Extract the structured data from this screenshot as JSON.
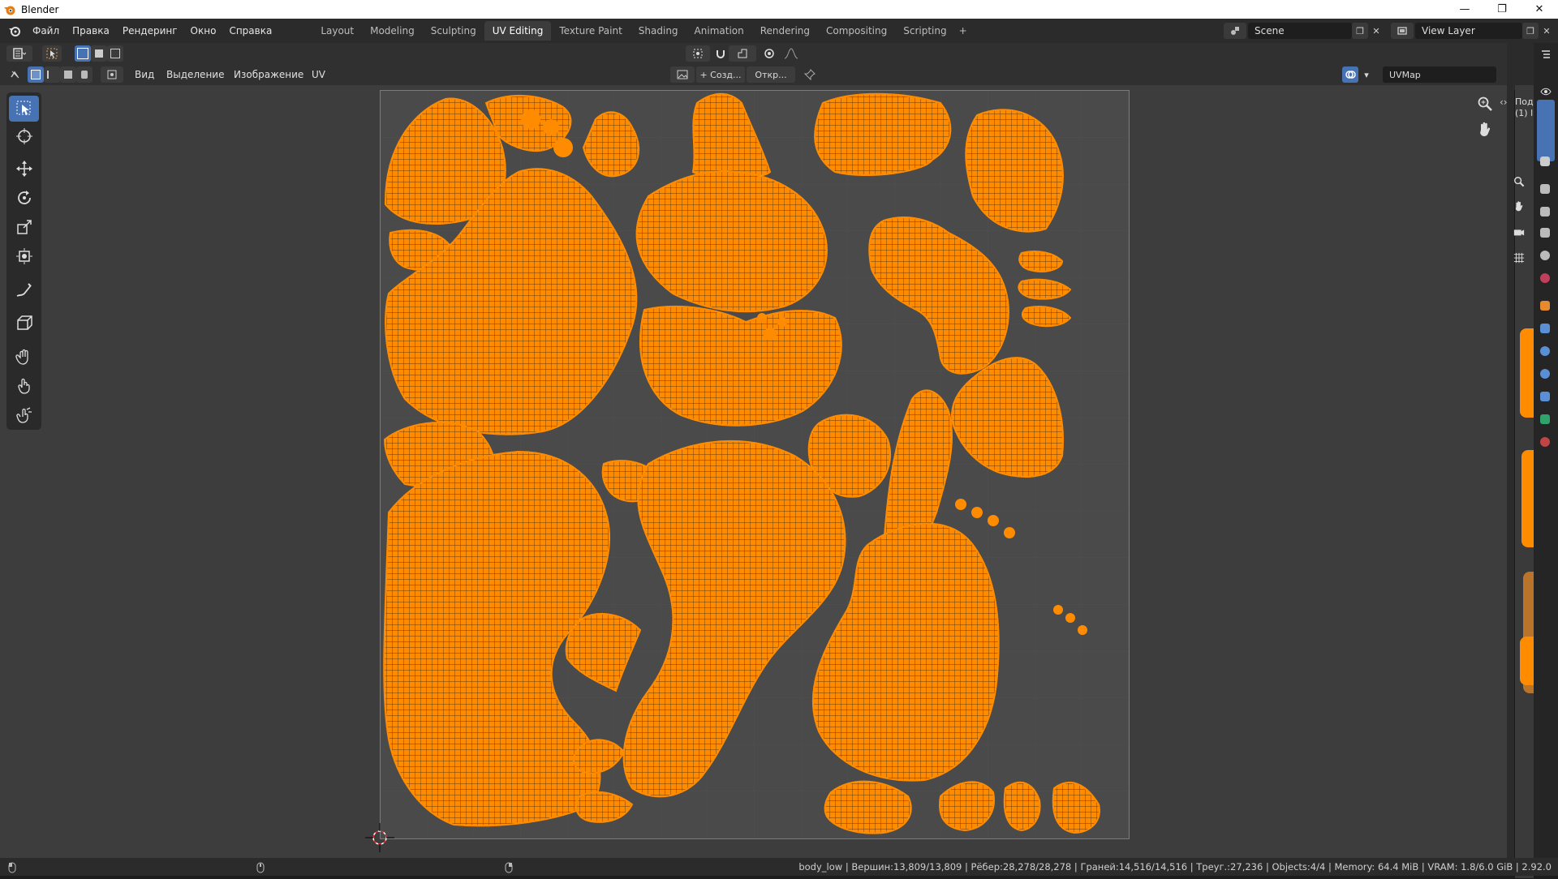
{
  "window": {
    "title": "Blender",
    "controls": {
      "minimize": "—",
      "maximize": "❐",
      "close": "✕"
    }
  },
  "menu": [
    "Файл",
    "Правка",
    "Рендеринг",
    "Окно",
    "Справка"
  ],
  "workspaces": {
    "tabs": [
      "Layout",
      "Modeling",
      "Sculpting",
      "UV Editing",
      "Texture Paint",
      "Shading",
      "Animation",
      "Rendering",
      "Compositing",
      "Scripting"
    ],
    "active": "UV Editing",
    "add": "+"
  },
  "scene": {
    "name": "Scene",
    "view_layer": "View Layer"
  },
  "uv_editor": {
    "header_menus": [
      "Вид",
      "Выделение",
      "Изображение",
      "UV"
    ],
    "new_image": "+ Созд...",
    "open_image": "Откр...",
    "uv_map": "UVMap"
  },
  "side_text": {
    "line1": "Под",
    "line2": "(1) l"
  },
  "tools": [
    "select-box",
    "cursor",
    "move",
    "rotate",
    "scale",
    "transform",
    "annotate",
    "rip-region",
    "grab",
    "relax",
    "pinch"
  ],
  "status_bar": {
    "text": "body_low | Вершин:13,809/13,809 | Рёбер:28,278/28,278 | Граней:14,516/14,516 | Треуг.:27,236 | Objects:4/4 | Memory: 64.4 MiB | VRAM: 1.8/6.0 GiB | 2.92.0"
  },
  "colors": {
    "uv_island": "#ff8c00",
    "uv_wire": "#6a3a08",
    "active_blue": "#4772b3",
    "background": "#3d3d3d"
  }
}
